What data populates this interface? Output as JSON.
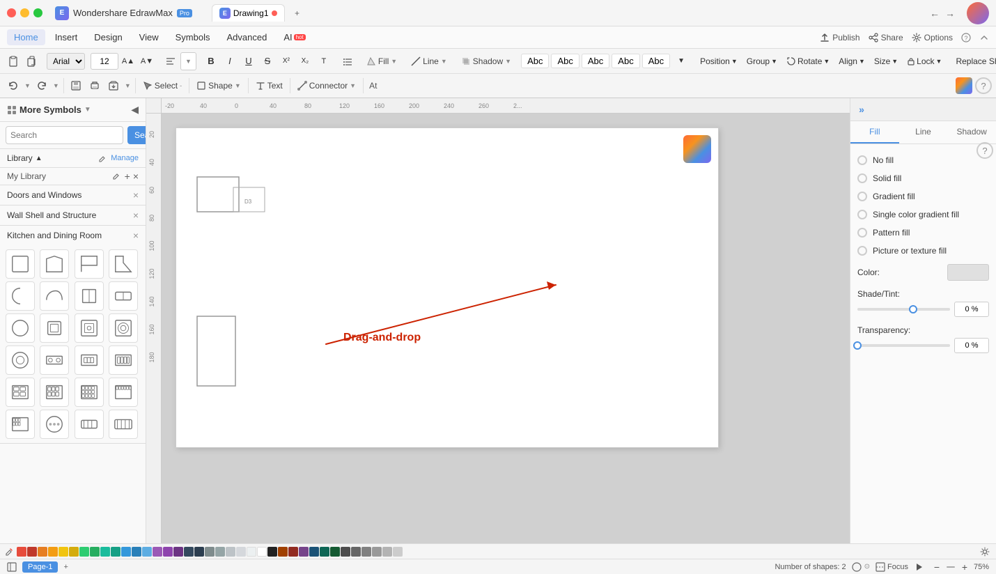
{
  "titlebar": {
    "app_name": "Wondershare EdrawMax",
    "badge": "Pro",
    "tab_name": "Drawing1",
    "icons": {
      "back": "←",
      "forward": "→"
    }
  },
  "menubar": {
    "items": [
      "Home",
      "Insert",
      "Design",
      "View",
      "Symbols",
      "Advanced",
      "AI"
    ],
    "ai_hot": true,
    "right_items": [
      "Publish",
      "Share",
      "Options"
    ]
  },
  "toolbar": {
    "font": "Arial",
    "font_size": "12",
    "tools": {
      "select_label": "Select",
      "shape_label": "Shape",
      "text_label": "Text",
      "connector_label": "Connector"
    },
    "fill_label": "Fill",
    "line_label": "Line",
    "shadow_label": "Shadow",
    "position_label": "Position",
    "group_label": "Group",
    "rotate_label": "Rotate",
    "align_label": "Align",
    "size_label": "Size",
    "lock_label": "Lock",
    "replace_shape_label": "Replace Shape"
  },
  "sidebar": {
    "title": "More Symbols",
    "search_placeholder": "Search",
    "search_btn": "Search",
    "library_label": "Library",
    "manage_label": "Manage",
    "collapse_icon": "▴",
    "my_library": "My Library",
    "sections": [
      {
        "name": "Doors and Windows",
        "has_close": true
      },
      {
        "name": "Wall Shell and Structure",
        "has_close": true
      },
      {
        "name": "Kitchen and Dining Room",
        "has_close": true
      }
    ]
  },
  "right_panel": {
    "tabs": [
      "Fill",
      "Line",
      "Shadow"
    ],
    "active_tab": "Fill",
    "fill_options": [
      {
        "id": "no-fill",
        "label": "No fill",
        "checked": false
      },
      {
        "id": "solid-fill",
        "label": "Solid fill",
        "checked": false
      },
      {
        "id": "gradient-fill",
        "label": "Gradient fill",
        "checked": false
      },
      {
        "id": "single-color-gradient",
        "label": "Single color gradient fill",
        "checked": false
      },
      {
        "id": "pattern-fill",
        "label": "Pattern fill",
        "checked": false
      },
      {
        "id": "picture-texture",
        "label": "Picture or texture fill",
        "checked": false
      }
    ],
    "color_label": "Color:",
    "shade_tint_label": "Shade/Tint:",
    "transparency_label": "Transparency:",
    "shade_value": "0 %",
    "transparency_value": "0 %"
  },
  "canvas": {
    "drag_label": "Drag-and-drop",
    "shapes_count": "Number of shapes: 2"
  },
  "bottom_bar": {
    "page_label": "Page-1",
    "page_tab": "Page-1",
    "add_page": "+",
    "shapes_count": "Number of shapes: 2",
    "focus_label": "Focus",
    "zoom_level": "75%"
  },
  "colors": [
    "#cc0000",
    "#e74c3c",
    "#e67e22",
    "#f39c12",
    "#f1c40f",
    "#2ecc71",
    "#27ae60",
    "#1abc9c",
    "#16a085",
    "#3498db",
    "#2980b9",
    "#9b59b6",
    "#8e44ad",
    "#34495e",
    "#2c3e50",
    "#7f8c8d",
    "#95a5a6",
    "#bdc3c7",
    "#ecf0f1",
    "#ffffff",
    "#000000",
    "#d35400",
    "#c0392b",
    "#a93226",
    "#922b21",
    "#7b241c",
    "#641e16"
  ],
  "styles": [
    "Abc",
    "Abc",
    "Abc",
    "Abc",
    "Abc"
  ]
}
